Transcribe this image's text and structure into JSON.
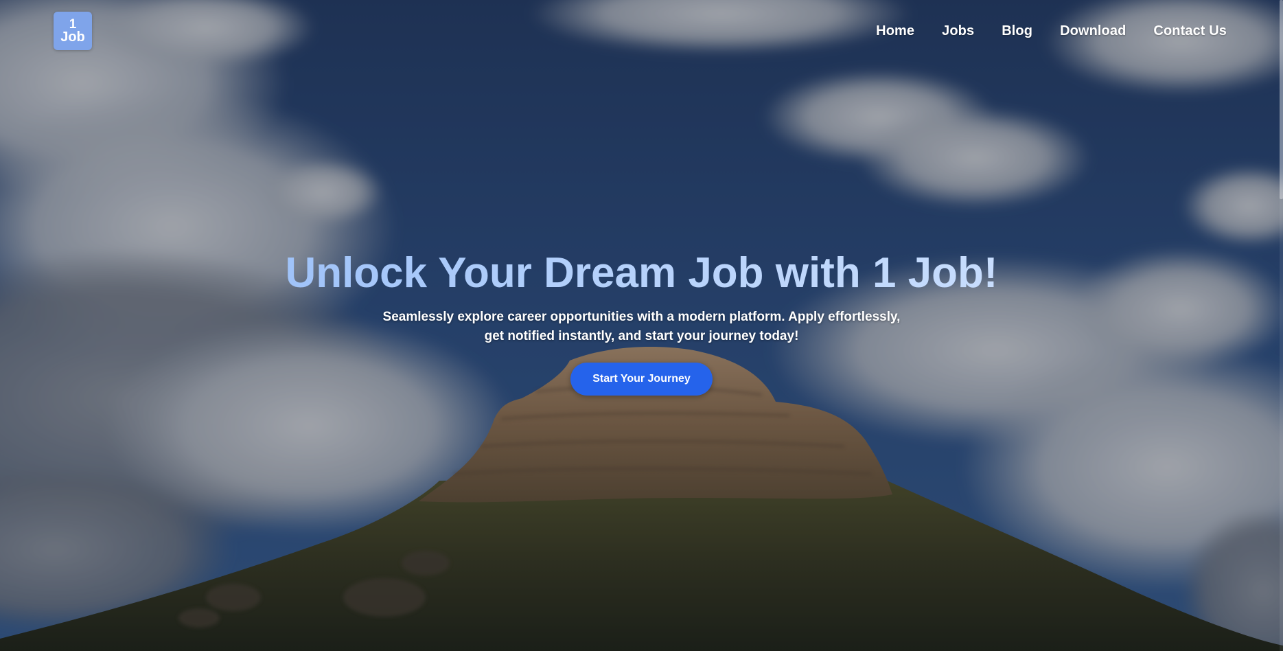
{
  "header": {
    "logo": {
      "line1": "1",
      "line2": "Job"
    },
    "nav": [
      {
        "label": "Home"
      },
      {
        "label": "Jobs"
      },
      {
        "label": "Blog"
      },
      {
        "label": "Download"
      },
      {
        "label": "Contact Us"
      }
    ]
  },
  "hero": {
    "title": "Unlock Your Dream Job with 1 Job!",
    "subtitle": "Seamlessly explore career opportunities with a modern platform. Apply effortlessly, get notified instantly, and start your journey today!",
    "cta_label": "Start Your Journey"
  },
  "colors": {
    "accent": "#2563eb",
    "logo_bg": "#7fa4ea",
    "title_gradient_start": "#8db6f7",
    "title_gradient_end": "#d6e6ff"
  }
}
